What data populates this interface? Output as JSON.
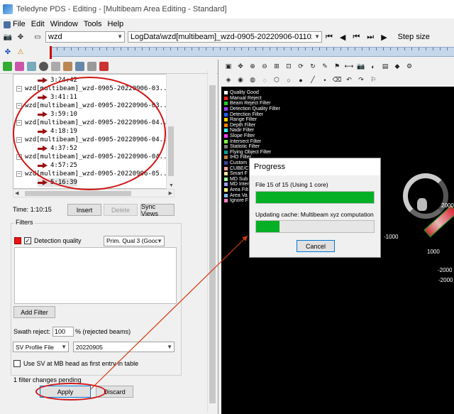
{
  "window": {
    "title": "Teledyne PDS - Editing - [Multibeam Area Editing - Standard]"
  },
  "menu": [
    "File",
    "Edit",
    "Window",
    "Tools",
    "Help"
  ],
  "toolbar": {
    "vessel": "wzd",
    "logdata_path": "LogData\\wzd[multibeam]_wzd-0905-20220906-011026",
    "step_size_label": "Step size"
  },
  "tree": {
    "rows": [
      {
        "type": "time",
        "text": "3:24:42"
      },
      {
        "type": "file",
        "text": "wzd[multibeam]_wzd-0905-20220906-03..."
      },
      {
        "type": "time",
        "text": "3:41:11"
      },
      {
        "type": "file",
        "text": "wzd[multibeam]_wzd-0905-20220906-03..."
      },
      {
        "type": "time",
        "text": "3:59:10"
      },
      {
        "type": "file",
        "text": "wzd[multibeam]_wzd-0905-20220906-04..."
      },
      {
        "type": "time",
        "text": "4:18:19"
      },
      {
        "type": "file",
        "text": "wzd[multibeam]_wzd-0905-20220906-04..."
      },
      {
        "type": "time",
        "text": "4:37:52"
      },
      {
        "type": "file",
        "text": "wzd[multibeam]_wzd-0905-20220906-04..."
      },
      {
        "type": "time",
        "text": "4:57:25"
      },
      {
        "type": "file",
        "text": "wzd[multibeam]_wzd-0905-20220906-05..."
      },
      {
        "type": "time",
        "text": "5:16:39"
      }
    ]
  },
  "time_panel": {
    "label": "Time:",
    "value": "1:10:15",
    "insert": "Insert",
    "delete": "Delete",
    "sync_views": "Sync Views"
  },
  "filters": {
    "title": "Filters",
    "item_label": "Detection quality",
    "item_checked": true,
    "item_option": "Prim. Qual 3 (Gooc",
    "add_filter": "Add Filter",
    "swath_reject_label": "Swath reject:",
    "swath_reject_value": "100",
    "swath_reject_unit": "% (rejected beams)",
    "sv_type": "SV Profile File",
    "sv_date": "20220905",
    "use_sv_label": "Use SV at MB head as first entry in table",
    "pending": "1 filter changes pending",
    "apply": "Apply",
    "discard": "Discard"
  },
  "legend": [
    {
      "label": "Quality Good",
      "color": "#ffffff"
    },
    {
      "label": "Manual Reject",
      "color": "#ff2020"
    },
    {
      "label": "Beam Reject Filter",
      "color": "#20d020"
    },
    {
      "label": "Detection Quality Filter",
      "color": "#a040ff"
    },
    {
      "label": "Detection Filter",
      "color": "#2060ff"
    },
    {
      "label": "Range Filter",
      "color": "#ffd000"
    },
    {
      "label": "Depth Filter",
      "color": "#ff8000"
    },
    {
      "label": "Nadir Filter",
      "color": "#40ffff"
    },
    {
      "label": "Slope Filter",
      "color": "#ff40ff"
    },
    {
      "label": "Intersect Filter",
      "color": "#80ff40"
    },
    {
      "label": "Statistic Filter",
      "color": "#808080"
    },
    {
      "label": "Flying Object Filter",
      "color": "#00a0a0"
    },
    {
      "label": "IHO Filter",
      "color": "#c08040"
    },
    {
      "label": "Custom",
      "color": "#4040a0"
    },
    {
      "label": "CUBE/C",
      "color": "#ffa0a0"
    },
    {
      "label": "Smart F",
      "color": "#ffe0a0"
    },
    {
      "label": "MD Sub",
      "color": "#a0ffa0"
    },
    {
      "label": "MD Inter",
      "color": "#a0a0ff"
    },
    {
      "label": "Area Filt",
      "color": "#ffff80"
    },
    {
      "label": "Area Va",
      "color": "#80c0ff"
    },
    {
      "label": "Ignore F",
      "color": "#ff80c0"
    }
  ],
  "viewer_axis": [
    "-1000",
    "-2000",
    "2000",
    "1000",
    "-2000"
  ],
  "progress": {
    "title": "Progress",
    "file_status": "File 15 of 15 (Using 1 core)",
    "file_progress": 1.0,
    "cache_status": "Updating cache: Multibeam xyz computation",
    "cache_progress": 0.2,
    "cancel": "Cancel"
  }
}
